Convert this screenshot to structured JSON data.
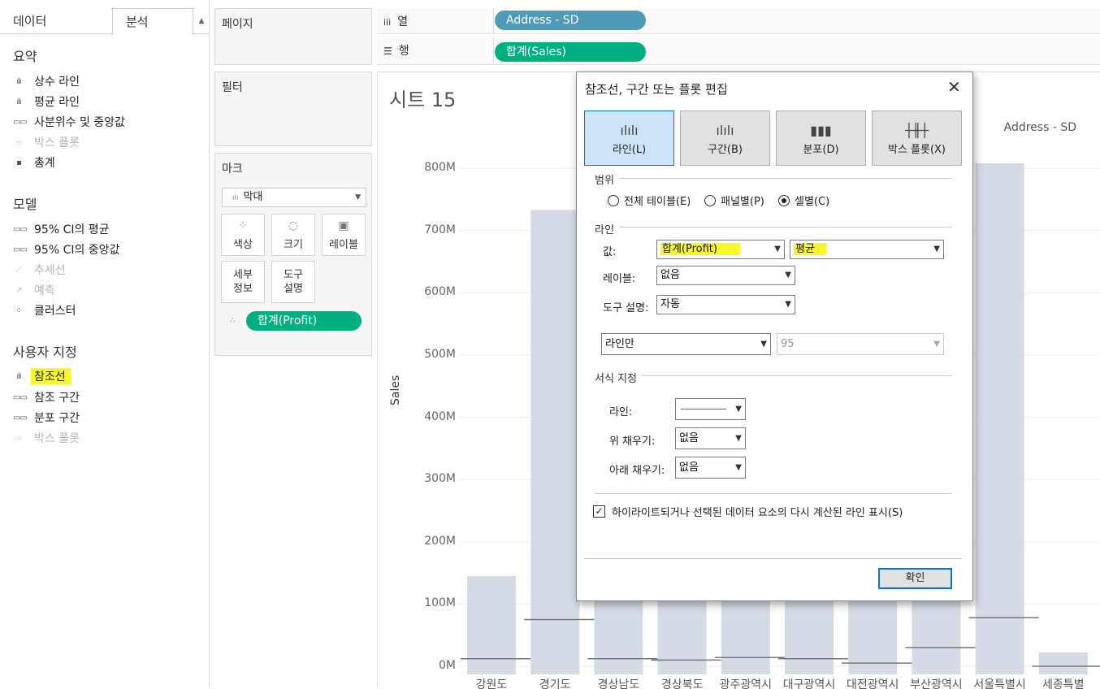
{
  "left_pane": {
    "tab_data": "데이터",
    "tab_analysis": "분석",
    "summary": {
      "header": "요약",
      "items": [
        "상수 라인",
        "평균 라인",
        "사분위수 및 중앙값",
        "박스 플롯",
        "총계"
      ]
    },
    "model": {
      "header": "모델",
      "items": [
        "95% CI의 평균",
        "95% CI의 중앙값",
        "추세선",
        "예측",
        "클러스터"
      ]
    },
    "custom": {
      "header": "사용자 지정",
      "items": [
        "참조선",
        "참조 구간",
        "분포 구간",
        "박스 플롯"
      ]
    }
  },
  "cards": {
    "pages": "페이지",
    "filters": "필터",
    "marks": "마크",
    "mark_type": "막대",
    "mark_buttons": [
      "색상",
      "크기",
      "레이블",
      "세부\n정보",
      "도구\n설명"
    ],
    "mark_pill": "합계(Profit)"
  },
  "shelves": {
    "columns_label": "열",
    "columns_pill": "Address - SD",
    "rows_label": "행",
    "rows_pill": "합계(Sales)"
  },
  "view": {
    "sheet_title": "시트 15",
    "header_label": "Address - SD"
  },
  "chart_data": {
    "type": "bar",
    "ylabel": "Sales",
    "ylim": [
      0,
      800000000
    ],
    "y_ticks": [
      "0M",
      "100M",
      "200M",
      "300M",
      "400M",
      "500M",
      "600M",
      "700M",
      "800M"
    ],
    "categories": [
      "강원도",
      "경기도",
      "경상남도",
      "경상북도",
      "광주광역시",
      "대구광역시",
      "대전광역시",
      "부산광역시",
      "서울특별시",
      "세종특별"
    ],
    "values": [
      145000000,
      733000000,
      230000000,
      230000000,
      230000000,
      230000000,
      230000000,
      230000000,
      808000000,
      22000000
    ],
    "reference_line_values": [
      12000000,
      75000000,
      12000000,
      10000000,
      14000000,
      12000000,
      5000000,
      30000000,
      78000000,
      0
    ]
  },
  "dialog": {
    "title": "참조선, 구간 또는 플롯 편집",
    "type_buttons": [
      "라인(L)",
      "구간(B)",
      "분포(D)",
      "박스 플롯(X)"
    ],
    "scope_group": "범위",
    "scope_options": [
      "전체 테이블(E)",
      "패널별(P)",
      "셀별(C)"
    ],
    "line_group": "라인",
    "value_label": "값:",
    "value_field": "합계(Profit)",
    "value_agg": "평균",
    "label_label": "레이블:",
    "label_value": "없음",
    "tooltip_label": "도구 설명:",
    "tooltip_value": "자동",
    "line_only": "라인만",
    "confidence": "95",
    "format_group": "서식 지정",
    "fmt_line_label": "라인:",
    "fmt_above_label": "위 채우기:",
    "fmt_above_value": "없음",
    "fmt_below_label": "아래 채우기:",
    "fmt_below_value": "없음",
    "recalc_checkbox": "하이라이트되거나 선택된 데이터 요소의 다시 계산된 라인 표시(S)",
    "ok": "확인"
  },
  "colors": {
    "column_pill": "#4e9bb9",
    "measure_pill": "#00b180",
    "bar": "#d5dbe4",
    "highlight": "#f7f72a",
    "selected_button": "#cce4f7"
  }
}
